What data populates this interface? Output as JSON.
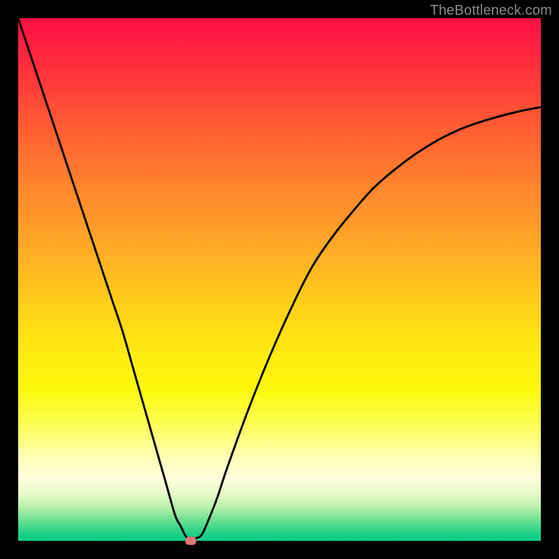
{
  "watermark": "TheBottleneck.com",
  "colors": {
    "curve": "#000000",
    "marker": "#e17a7e",
    "gradient_top": "#ff0e45",
    "gradient_bottom": "#0acd86"
  },
  "chart_data": {
    "type": "line",
    "title": "",
    "xlabel": "",
    "ylabel": "",
    "xlim": [
      0,
      100
    ],
    "ylim": [
      0,
      100
    ],
    "grid": false,
    "legend": false,
    "min_point": {
      "x": 33,
      "y": 0
    },
    "series": [
      {
        "name": "bottleneck-curve",
        "x": [
          0,
          2,
          4,
          6,
          8,
          10,
          12,
          14,
          16,
          18,
          20,
          22,
          24,
          26,
          28,
          30,
          31,
          32,
          33,
          34,
          35,
          36,
          38,
          40,
          44,
          48,
          52,
          56,
          60,
          64,
          68,
          72,
          76,
          80,
          84,
          88,
          92,
          96,
          100
        ],
        "y": [
          100,
          94,
          88,
          82,
          76,
          70,
          64,
          58,
          52,
          46,
          40,
          33,
          26,
          19,
          12,
          5,
          3,
          1,
          0,
          0.5,
          1,
          3,
          8,
          14,
          25,
          35,
          44,
          52,
          58,
          63,
          67.5,
          71,
          74,
          76.5,
          78.5,
          80,
          81.2,
          82.2,
          83
        ]
      }
    ]
  }
}
